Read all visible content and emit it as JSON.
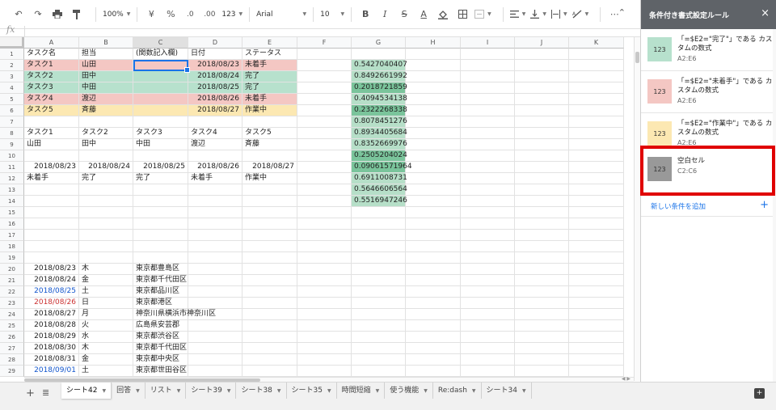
{
  "toolbar": {
    "zoom": "100%",
    "currency": "¥",
    "percent": "%",
    "dec_less": ".0",
    "dec_more": ".00",
    "format_more": "123",
    "font": "Arial",
    "font_size": "10",
    "more": "⋯"
  },
  "formula_bar": {
    "fx": "fx"
  },
  "columns": [
    "A",
    "B",
    "C",
    "D",
    "E",
    "F",
    "G",
    "H",
    "I",
    "J",
    "K"
  ],
  "rows": [
    {
      "n": "1",
      "cells": [
        "タスク名",
        "担当",
        "(関数記入欄)",
        "日付",
        "ステータス",
        "",
        "",
        "",
        "",
        "",
        ""
      ]
    },
    {
      "n": "2",
      "cells": [
        "タスク1",
        "山田",
        "",
        "2018/08/23",
        "未着手",
        "",
        "0.5427040407",
        "",
        "",
        "",
        ""
      ]
    },
    {
      "n": "3",
      "cells": [
        "タスク2",
        "田中",
        "",
        "2018/08/24",
        "完了",
        "",
        "0.8492661992",
        "",
        "",
        "",
        ""
      ]
    },
    {
      "n": "4",
      "cells": [
        "タスク3",
        "中田",
        "",
        "2018/08/25",
        "完了",
        "",
        "0.2018721859",
        "",
        "",
        "",
        ""
      ]
    },
    {
      "n": "5",
      "cells": [
        "タスク4",
        "渡辺",
        "",
        "2018/08/26",
        "未着手",
        "",
        "0.4094534138",
        "",
        "",
        "",
        ""
      ]
    },
    {
      "n": "6",
      "cells": [
        "タスク5",
        "斉藤",
        "",
        "2018/08/27",
        "作業中",
        "",
        "0.2322268338",
        "",
        "",
        "",
        ""
      ]
    },
    {
      "n": "7",
      "cells": [
        "",
        "",
        "",
        "",
        "",
        "",
        "0.8078451276",
        "",
        "",
        "",
        ""
      ]
    },
    {
      "n": "8",
      "cells": [
        "タスク1",
        "タスク2",
        "タスク3",
        "タスク4",
        "タスク5",
        "",
        "0.8934405684",
        "",
        "",
        "",
        ""
      ]
    },
    {
      "n": "9",
      "cells": [
        "山田",
        "田中",
        "中田",
        "渡辺",
        "斉藤",
        "",
        "0.8352669976",
        "",
        "",
        "",
        ""
      ]
    },
    {
      "n": "10",
      "cells": [
        "",
        "",
        "",
        "",
        "",
        "",
        "0.2505204024",
        "",
        "",
        "",
        ""
      ]
    },
    {
      "n": "11",
      "cells": [
        "2018/08/23",
        "2018/08/24",
        "2018/08/25",
        "2018/08/26",
        "2018/08/27",
        "",
        "0.09061571964",
        "",
        "",
        "",
        ""
      ]
    },
    {
      "n": "12",
      "cells": [
        "未着手",
        "完了",
        "完了",
        "未着手",
        "作業中",
        "",
        "0.6911008731",
        "",
        "",
        "",
        ""
      ]
    },
    {
      "n": "13",
      "cells": [
        "",
        "",
        "",
        "",
        "",
        "",
        "0.5646606564",
        "",
        "",
        "",
        ""
      ]
    },
    {
      "n": "14",
      "cells": [
        "",
        "",
        "",
        "",
        "",
        "",
        "0.5516947246",
        "",
        "",
        "",
        ""
      ]
    },
    {
      "n": "15",
      "cells": [
        "",
        "",
        "",
        "",
        "",
        "",
        "",
        "",
        "",
        "",
        ""
      ]
    },
    {
      "n": "16",
      "cells": [
        "",
        "",
        "",
        "",
        "",
        "",
        "",
        "",
        "",
        "",
        ""
      ]
    },
    {
      "n": "17",
      "cells": [
        "",
        "",
        "",
        "",
        "",
        "",
        "",
        "",
        "",
        "",
        ""
      ]
    },
    {
      "n": "18",
      "cells": [
        "",
        "",
        "",
        "",
        "",
        "",
        "",
        "",
        "",
        "",
        ""
      ]
    },
    {
      "n": "19",
      "cells": [
        "",
        "",
        "",
        "",
        "",
        "",
        "",
        "",
        "",
        "",
        ""
      ]
    },
    {
      "n": "20",
      "cells": [
        "2018/08/23",
        "木",
        "東京都豊島区",
        "",
        "",
        "",
        "",
        "",
        "",
        "",
        ""
      ]
    },
    {
      "n": "21",
      "cells": [
        "2018/08/24",
        "金",
        "東京都千代田区",
        "",
        "",
        "",
        "",
        "",
        "",
        "",
        ""
      ]
    },
    {
      "n": "22",
      "cells": [
        "2018/08/25",
        "土",
        "東京都品川区",
        "",
        "",
        "",
        "",
        "",
        "",
        "",
        ""
      ]
    },
    {
      "n": "23",
      "cells": [
        "2018/08/26",
        "日",
        "東京都港区",
        "",
        "",
        "",
        "",
        "",
        "",
        "",
        ""
      ]
    },
    {
      "n": "24",
      "cells": [
        "2018/08/27",
        "月",
        "神奈川県横浜市神奈川区",
        "",
        "",
        "",
        "",
        "",
        "",
        "",
        ""
      ]
    },
    {
      "n": "25",
      "cells": [
        "2018/08/28",
        "火",
        "広島県安芸郡",
        "",
        "",
        "",
        "",
        "",
        "",
        "",
        ""
      ]
    },
    {
      "n": "26",
      "cells": [
        "2018/08/29",
        "水",
        "東京都渋谷区",
        "",
        "",
        "",
        "",
        "",
        "",
        "",
        ""
      ]
    },
    {
      "n": "27",
      "cells": [
        "2018/08/30",
        "木",
        "東京都千代田区",
        "",
        "",
        "",
        "",
        "",
        "",
        "",
        ""
      ]
    },
    {
      "n": "28",
      "cells": [
        "2018/08/31",
        "金",
        "東京都中央区",
        "",
        "",
        "",
        "",
        "",
        "",
        "",
        ""
      ]
    },
    {
      "n": "29",
      "cells": [
        "2018/09/01",
        "土",
        "東京都世田谷区",
        "",
        "",
        "",
        "",
        "",
        "",
        "",
        ""
      ]
    }
  ],
  "sheet_tabs": [
    {
      "label": "シート42",
      "active": true
    },
    {
      "label": "回答",
      "active": false
    },
    {
      "label": "リスト",
      "active": false
    },
    {
      "label": "シート39",
      "active": false
    },
    {
      "label": "シート38",
      "active": false
    },
    {
      "label": "シート35",
      "active": false
    },
    {
      "label": "時間短縮",
      "active": false
    },
    {
      "label": "使う機能",
      "active": false
    },
    {
      "label": "Re:dash",
      "active": false
    },
    {
      "label": "シート34",
      "active": false
    }
  ],
  "panel": {
    "title": "条件付き書式設定ルール",
    "close": "×",
    "rules": [
      {
        "preview": "123",
        "title": "「=$E2=\"完了\"」である カスタムの数式",
        "range": "A2:E6",
        "color": "#b7e1cd"
      },
      {
        "preview": "123",
        "title": "「=$E2=\"未着手\"」である カスタムの数式",
        "range": "A2:E6",
        "color": "#f4c7c3"
      },
      {
        "preview": "123",
        "title": "「=$E2=\"作業中\"」である カスタムの数式",
        "range": "A2:E6",
        "color": "#fce8b2"
      },
      {
        "preview": "123",
        "title": "空白セル",
        "range": "C2:C6",
        "color": "#999999"
      }
    ],
    "add_rule": "新しい条件を追加",
    "add_plus": "+"
  },
  "colors": {
    "done": "#b7e1cd",
    "todo": "#f4c7c3",
    "in_progress": "#fce8b2",
    "highlight": "#e00000",
    "accent": "#1a73e8"
  }
}
